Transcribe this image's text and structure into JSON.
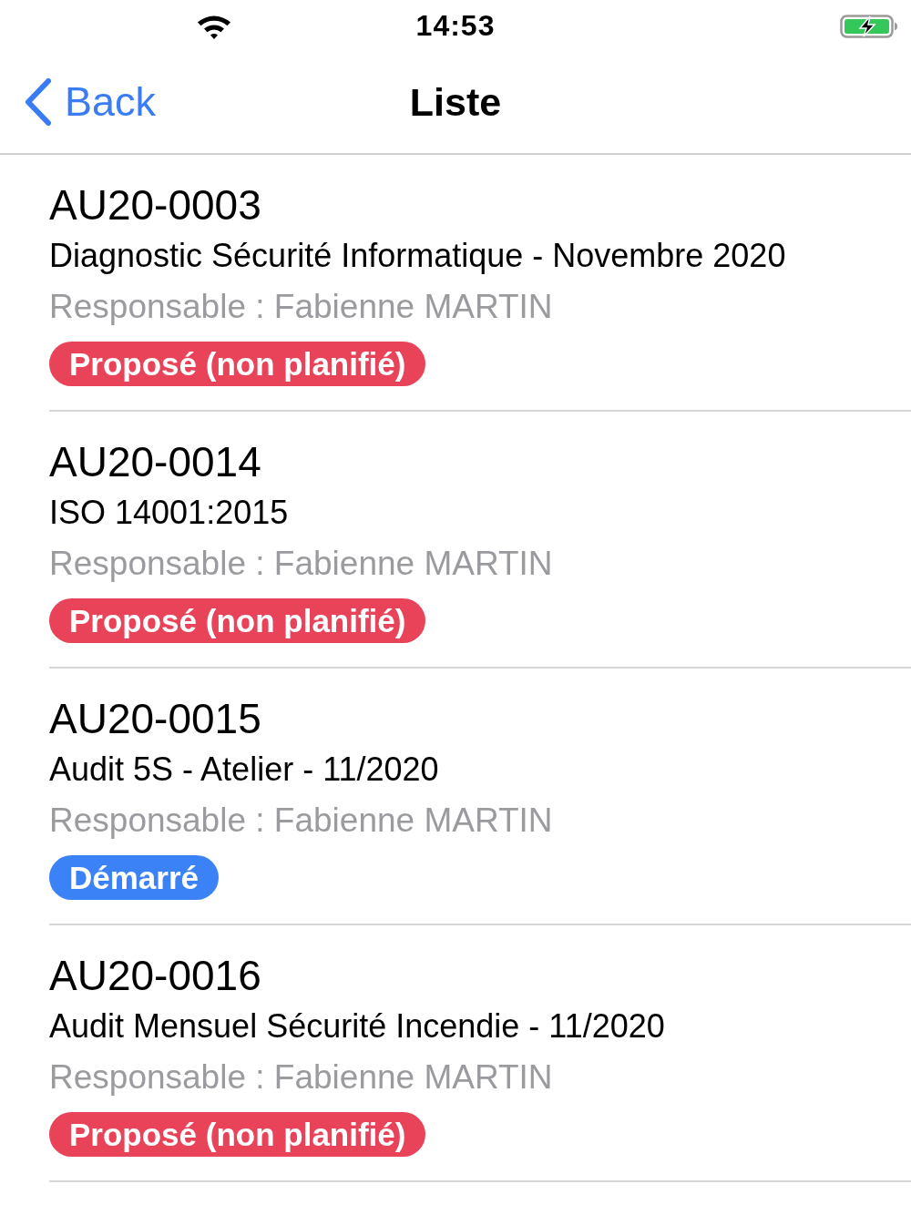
{
  "status_bar": {
    "time": "14:53"
  },
  "nav_bar": {
    "back_label": "Back",
    "title": "Liste"
  },
  "items": [
    {
      "code": "AU20-0003",
      "title": "Diagnostic Sécurité Informatique - Novembre 2020",
      "responsable": "Responsable : Fabienne MARTIN",
      "status": {
        "label": "Proposé (non planifié)",
        "color": "#e9435a"
      }
    },
    {
      "code": "AU20-0014",
      "title": "ISO 14001:2015",
      "responsable": "Responsable : Fabienne MARTIN",
      "status": {
        "label": "Proposé (non planifié)",
        "color": "#e9435a"
      }
    },
    {
      "code": "AU20-0015",
      "title": "Audit 5S - Atelier - 11/2020",
      "responsable": "Responsable : Fabienne MARTIN",
      "status": {
        "label": "Démarré",
        "color": "#3b82f7"
      }
    },
    {
      "code": "AU20-0016",
      "title": "Audit Mensuel Sécurité Incendie - 11/2020",
      "responsable": "Responsable : Fabienne MARTIN",
      "status": {
        "label": "Proposé (non planifié)",
        "color": "#e9435a"
      }
    }
  ]
}
